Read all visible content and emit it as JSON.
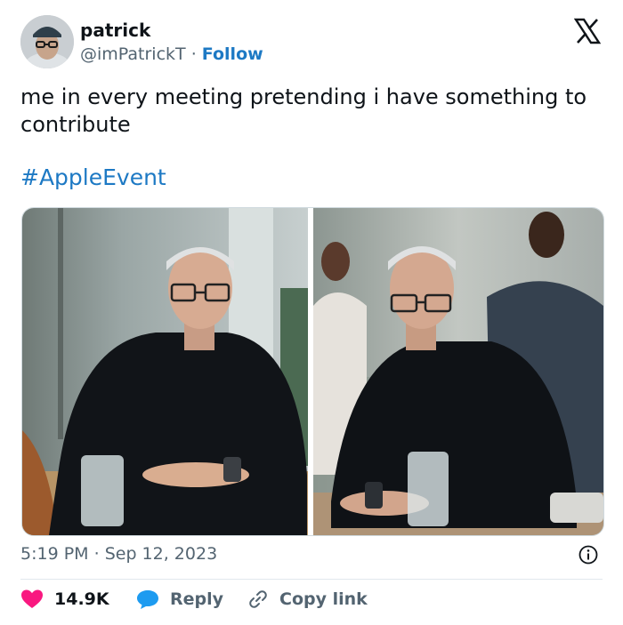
{
  "author": {
    "name": "patrick",
    "handle": "@imPatrickT",
    "separator": "·",
    "follow_label": "Follow",
    "avatar_icon": "profile-photo-glasses-cap"
  },
  "platform_icon": "x-logo-icon",
  "tweet": {
    "text": "me in every meeting pretending i have something to contribute",
    "hashtag": "#AppleEvent"
  },
  "media": [
    {
      "icon": "photo-man-glasses-black-shirt-seated-at-table-office"
    },
    {
      "icon": "photo-man-glasses-black-shirt-seated-at-table-people-behind"
    }
  ],
  "meta": {
    "time": "5:19 PM",
    "separator": "·",
    "date": "Sep 12, 2023"
  },
  "actions": {
    "likes": "14.9K",
    "reply_label": "Reply",
    "copy_link_label": "Copy link"
  },
  "colors": {
    "link": "#1d79c4",
    "heart": "#f91880",
    "reply_bubble": "#1d9bf0",
    "muted": "#536471"
  }
}
